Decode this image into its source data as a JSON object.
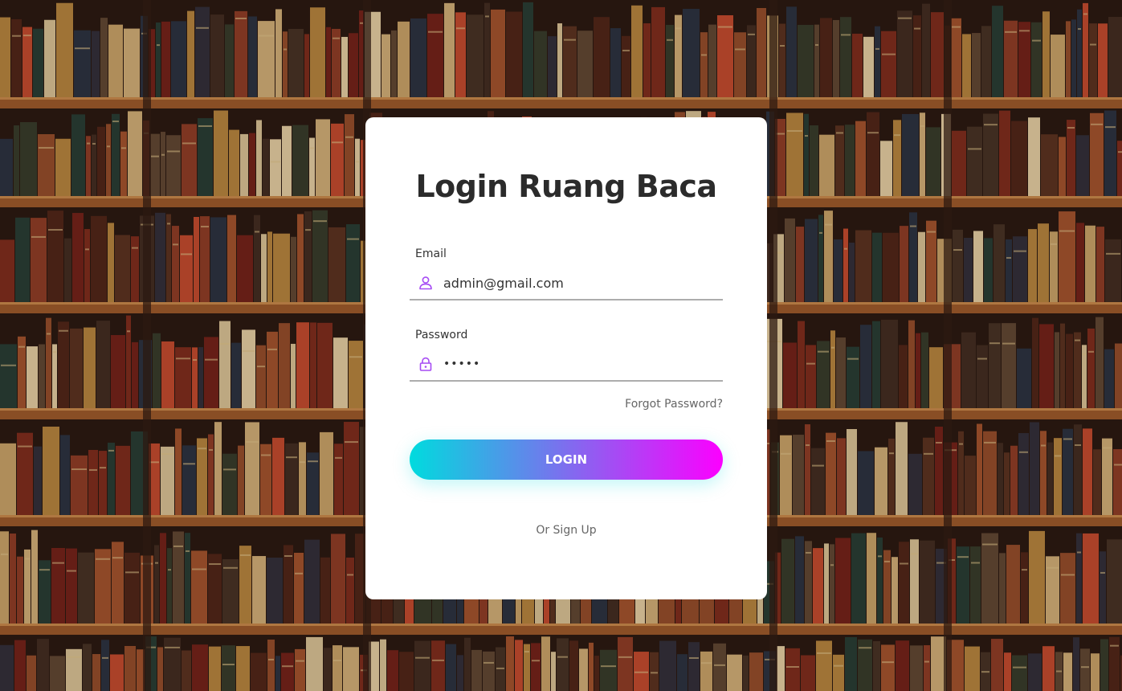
{
  "login": {
    "title": "Login Ruang Baca",
    "email": {
      "label": "Email",
      "value": "admin@gmail.com",
      "icon": "person-icon"
    },
    "password": {
      "label": "Password",
      "value": "•••••",
      "icon": "lock-icon"
    },
    "forgot_label": "Forgot Password?",
    "login_label": "LOGIN",
    "signup_label": "Or Sign Up"
  },
  "colors": {
    "gradient_start": "#00dbde",
    "gradient_end": "#fc00ff",
    "icon_accent": "#a64bf4"
  }
}
